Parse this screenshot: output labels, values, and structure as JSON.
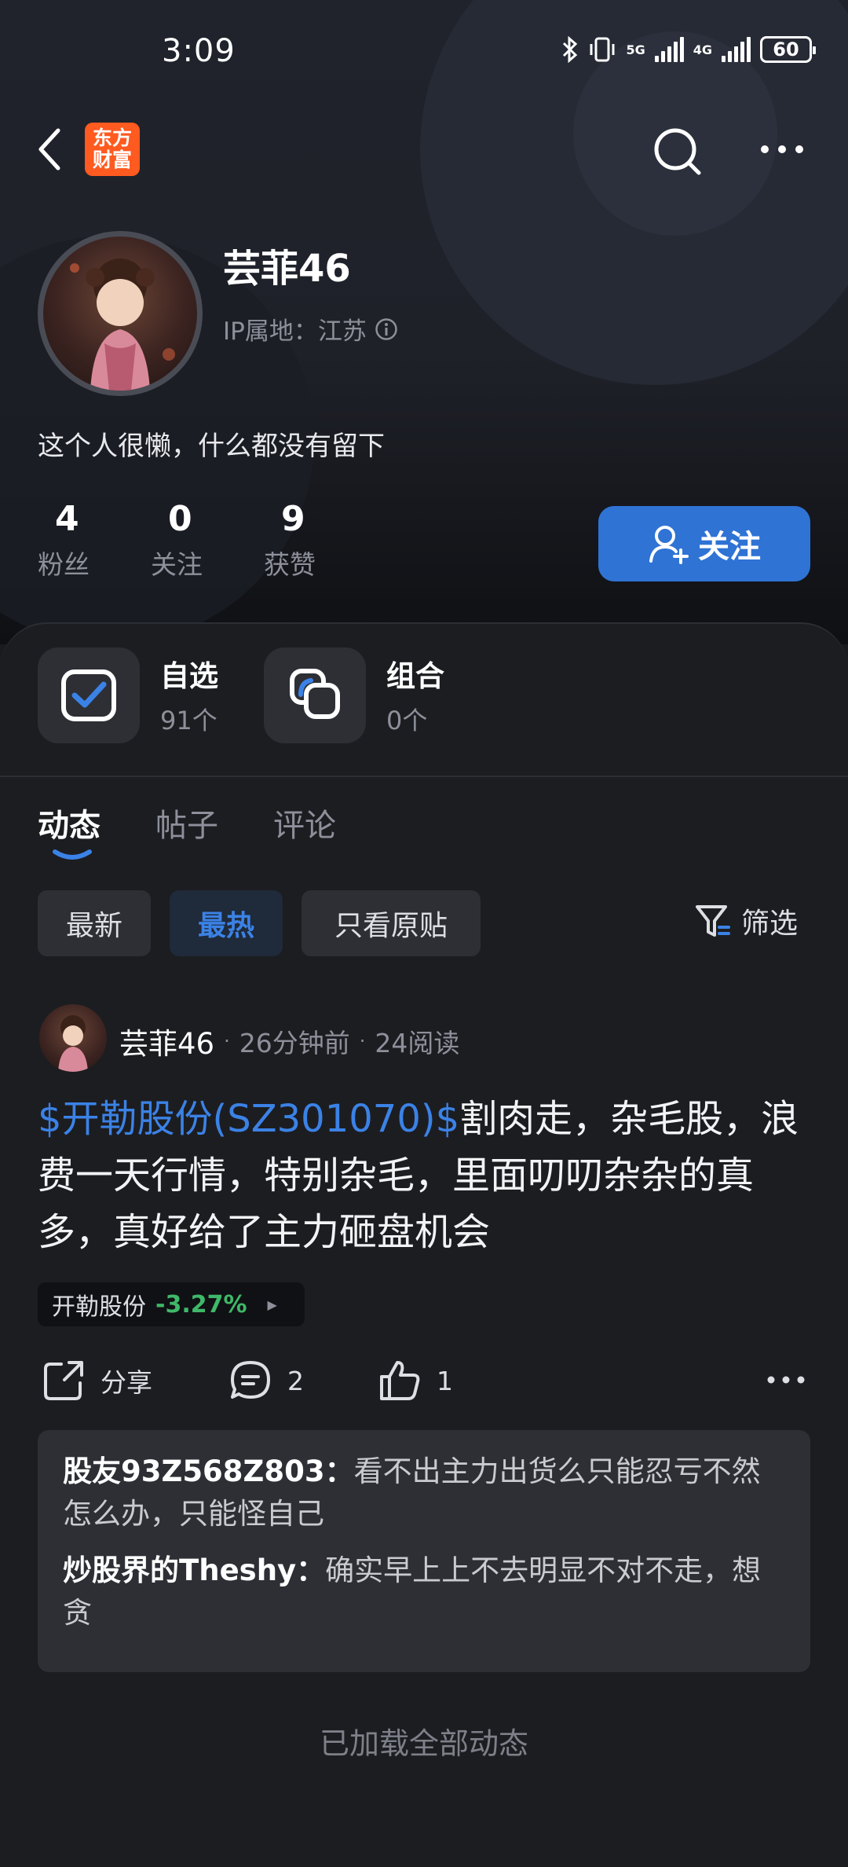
{
  "status": {
    "time": "3:09",
    "net1": "5G",
    "net2": "4G",
    "battery": "60"
  },
  "nav": {
    "logo_line1": "东方",
    "logo_line2": "财富"
  },
  "profile": {
    "name": "芸菲46",
    "ip": "IP属地：江苏",
    "bio": "这个人很懒，什么都没有留下",
    "stats": [
      {
        "num": "4",
        "label": "粉丝"
      },
      {
        "num": "0",
        "label": "关注"
      },
      {
        "num": "9",
        "label": "获赞"
      }
    ],
    "follow_label": "关注"
  },
  "tiles": [
    {
      "label": "自选",
      "count": "91个"
    },
    {
      "label": "组合",
      "count": "0个"
    }
  ],
  "tabs": [
    "动态",
    "帖子",
    "评论"
  ],
  "chips": [
    "最新",
    "最热",
    "只看原贴"
  ],
  "filter_label": "筛选",
  "post": {
    "author": "芸菲46",
    "time": "26分钟前",
    "reads": "24阅读",
    "stock_tag": "$开勒股份(SZ301070)$",
    "text": "割肉走，杂毛股，浪费一天行情，特别杂毛，里面叨叨杂杂的真多，真好给了主力砸盘机会",
    "stock_name": "开勒股份",
    "stock_change": "-3.27%",
    "share_label": "分享",
    "comment_count": "2",
    "like_count": "1"
  },
  "comments": [
    {
      "who": "股友93Z568Z803：",
      "text": "看不出主力出货么只能忍亏不然怎么办，只能怪自己"
    },
    {
      "who": "炒股界的Theshy：",
      "text": "确实早上上不去明显不对不走，想贪"
    }
  ],
  "end_text": "已加载全部动态",
  "colors": {
    "accent": "#2f73d4",
    "link": "#3b82e6",
    "down": "#3fb869",
    "logo": "#ff5a1f"
  }
}
